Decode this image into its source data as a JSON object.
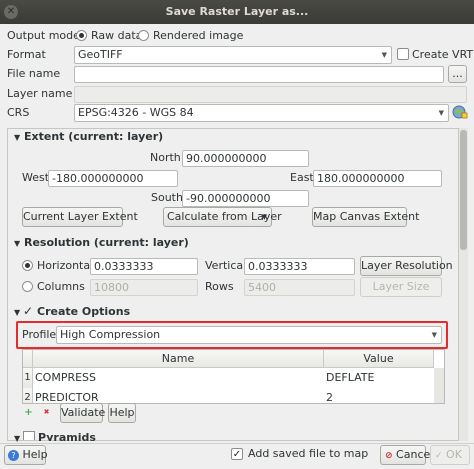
{
  "window": {
    "title": "Save Raster Layer as..."
  },
  "output_mode": {
    "label": "Output mode",
    "raw": "Raw data",
    "rendered": "Rendered image",
    "selected": "raw"
  },
  "format": {
    "label": "Format",
    "value": "GeoTIFF",
    "create_vrt": "Create VRT"
  },
  "file_name": {
    "label": "File name",
    "value": "",
    "browse": "..."
  },
  "layer_name": {
    "label": "Layer name",
    "value": ""
  },
  "crs": {
    "label": "CRS",
    "value": "EPSG:4326 - WGS 84"
  },
  "extent": {
    "title": "Extent (current: layer)",
    "north_label": "North",
    "north": "90.000000000",
    "west_label": "West",
    "west": "-180.000000000",
    "east_label": "East",
    "east": "180.000000000",
    "south_label": "South",
    "south": "-90.000000000",
    "btn_current": "Current Layer Extent",
    "btn_calc": "Calculate from Layer",
    "btn_map": "Map Canvas Extent"
  },
  "resolution": {
    "title": "Resolution (current: layer)",
    "horizontal_label": "Horizontal",
    "horizontal": "0.0333333",
    "vertical_label": "Vertical",
    "vertical": "0.0333333",
    "btn_layer_res": "Layer Resolution",
    "columns_label": "Columns",
    "columns": "10800",
    "rows_label": "Rows",
    "rows": "5400",
    "btn_layer_size": "Layer Size",
    "selected": "horizontal"
  },
  "create_options": {
    "title": "Create Options",
    "checked": true,
    "profile_label": "Profile",
    "profile": "High Compression",
    "table": {
      "headers": [
        "Name",
        "Value"
      ],
      "rows": [
        {
          "num": "1",
          "name": "COMPRESS",
          "value": "DEFLATE"
        },
        {
          "num": "2",
          "name": "PREDICTOR",
          "value": "2"
        }
      ]
    },
    "btn_validate": "Validate",
    "btn_help": "Help"
  },
  "pyramids": {
    "title": "Pyramids"
  },
  "footer": {
    "help": "Help",
    "add_to_map": "Add saved file to map",
    "add_checked": true,
    "cancel": "Cancel",
    "ok": "OK"
  }
}
